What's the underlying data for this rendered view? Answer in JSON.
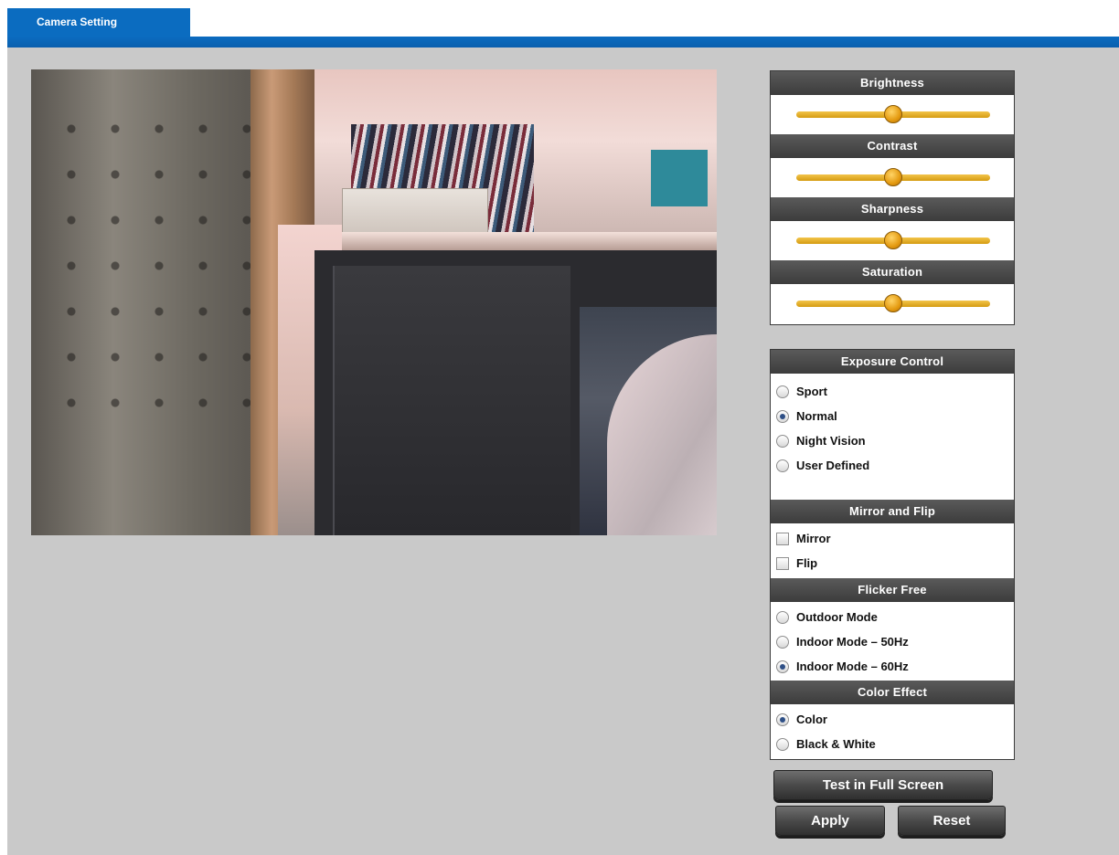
{
  "tabs": [
    {
      "label": "Camera Setting"
    }
  ],
  "image_controls": [
    {
      "label": "Brightness",
      "value": 0.5
    },
    {
      "label": "Contrast",
      "value": 0.5
    },
    {
      "label": "Sharpness",
      "value": 0.5
    },
    {
      "label": "Saturation",
      "value": 0.5
    }
  ],
  "exposure": {
    "title": "Exposure Control",
    "options": [
      {
        "label": "Sport",
        "selected": false
      },
      {
        "label": "Normal",
        "selected": true
      },
      {
        "label": "Night Vision",
        "selected": false
      },
      {
        "label": "User Defined",
        "selected": false
      }
    ]
  },
  "mirror_flip": {
    "title": "Mirror and Flip",
    "options": [
      {
        "label": "Mirror",
        "checked": false
      },
      {
        "label": "Flip",
        "checked": false
      }
    ]
  },
  "flicker": {
    "title": "Flicker Free",
    "options": [
      {
        "label": "Outdoor Mode",
        "selected": false
      },
      {
        "label": "Indoor Mode – 50Hz",
        "selected": false
      },
      {
        "label": "Indoor Mode – 60Hz",
        "selected": true
      }
    ]
  },
  "color_effect": {
    "title": "Color Effect",
    "options": [
      {
        "label": "Color",
        "selected": true
      },
      {
        "label": "Black & White",
        "selected": false
      }
    ]
  },
  "buttons": {
    "fullscreen": "Test in Full Screen",
    "apply": "Apply",
    "reset": "Reset"
  },
  "colors": {
    "tab_blue": "#0b6cc0",
    "panel_bg": "#c9c9c9",
    "header_dark": "#4a4a4a",
    "slider_gold": "#e3a91d"
  }
}
